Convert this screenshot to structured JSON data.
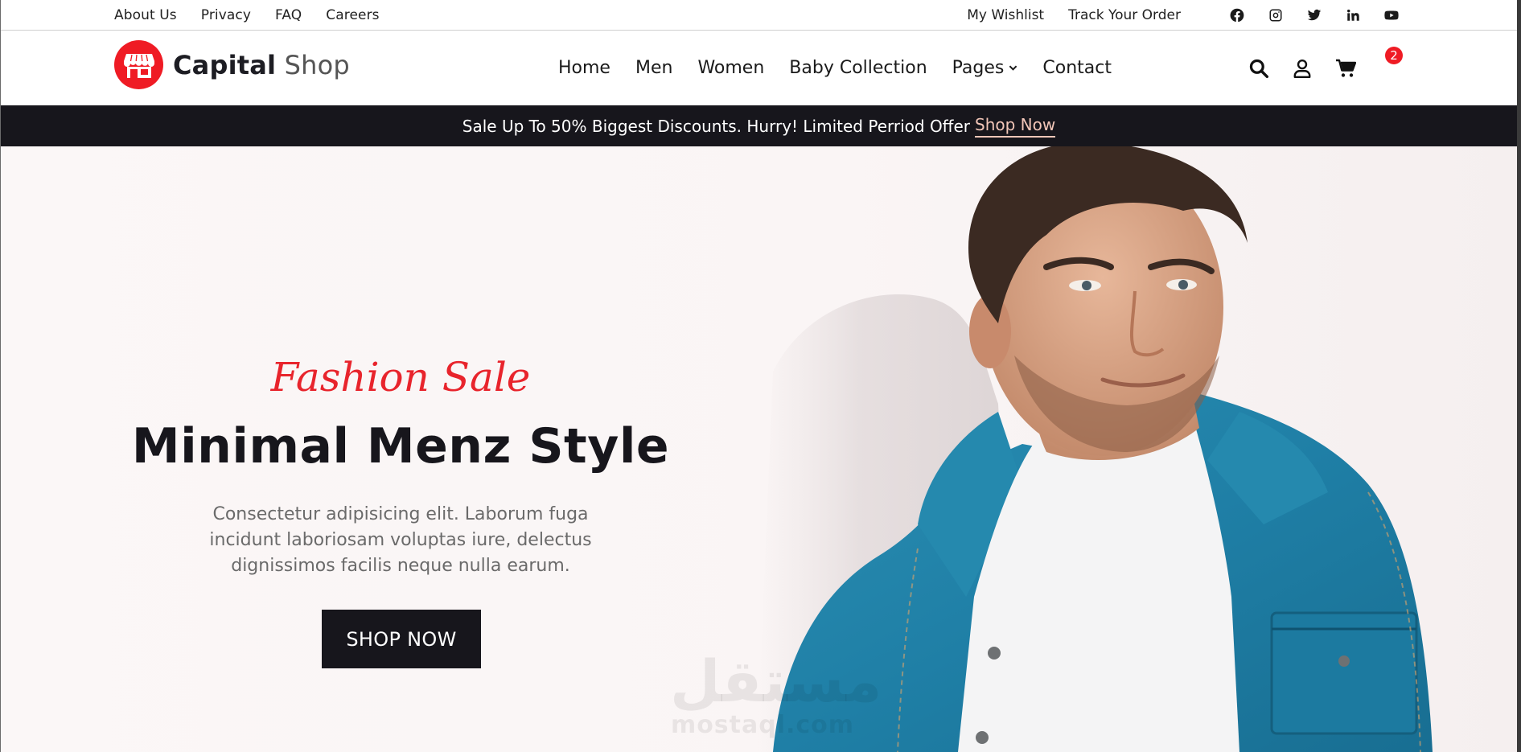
{
  "topbar": {
    "left_links": [
      "About Us",
      "Privacy",
      "FAQ",
      "Careers"
    ],
    "right_links": [
      "My Wishlist",
      "Track Your Order"
    ],
    "social_icons": [
      "facebook-icon",
      "instagram-icon",
      "twitter-icon",
      "linkedin-icon",
      "youtube-icon"
    ]
  },
  "brand": {
    "name_bold": "Capital",
    "name_light": "Shop",
    "accent_color": "#ef1b24"
  },
  "nav": {
    "items": [
      "Home",
      "Men",
      "Women",
      "Baby Collection",
      "Pages",
      "Contact"
    ],
    "icons": [
      "search-icon",
      "user-icon",
      "cart-icon"
    ],
    "cart_count": "2"
  },
  "promo": {
    "text": "Sale Up To 50% Biggest Discounts. Hurry! Limited Perriod Offer",
    "link": "Shop Now",
    "background": "#17161c",
    "link_color": "#f2c6b8"
  },
  "hero": {
    "kicker": "Fashion Sale",
    "title": "Minimal Menz Style",
    "description": "Consectetur adipisicing elit. Laborum fuga incidunt laboriosam voluptas iure, delectus dignissimos facilis neque nulla earum.",
    "cta": "SHOP NOW"
  },
  "watermark": {
    "arabic": "مستقل",
    "latin": "mostaql.com"
  }
}
